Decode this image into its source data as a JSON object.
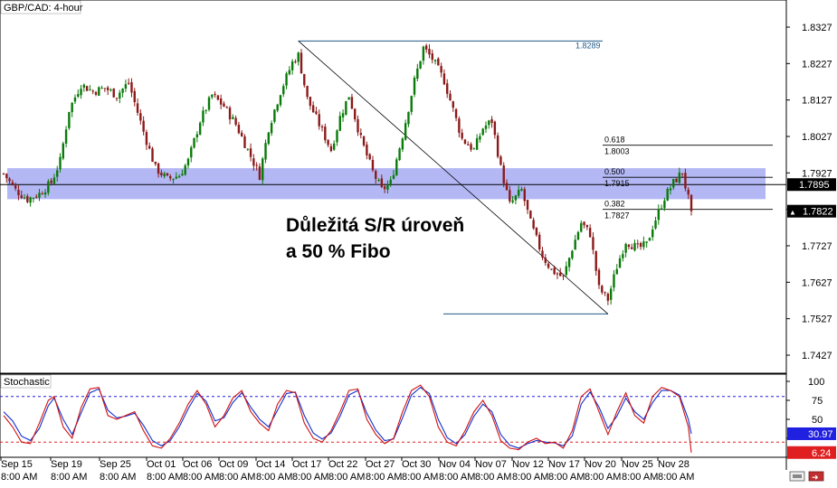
{
  "window": {
    "title": "GBP/CAD: 4-hour",
    "stoch_title": "Stochastic"
  },
  "annotation": {
    "line1": "Důležitá S/R úroveň",
    "line2": "a 50 % Fibo"
  },
  "colors": {
    "up_candle": "#0a7a0a",
    "down_candle": "#8b1a1a",
    "sr_zone": "#9aa0f0",
    "stoch_k": "#d01010",
    "stoch_d": "#1030d0",
    "level_line": "#000000",
    "badge_dark": "#000000",
    "badge_blue": "#2020e0",
    "badge_red": "#e02020"
  },
  "chart_data": [
    {
      "type": "candlestick",
      "title": "GBP/CAD: 4-hour",
      "ylim": [
        1.742,
        1.835
      ],
      "yticks": [
        "1.8327",
        "1.8227",
        "1.8127",
        "1.8027",
        "1.7927",
        "1.7827",
        "1.7727",
        "1.7627",
        "1.7527",
        "1.7427"
      ],
      "ytick_values": [
        1.8327,
        1.8227,
        1.8127,
        1.8027,
        1.7927,
        1.7827,
        1.7727,
        1.7627,
        1.7527,
        1.7427
      ],
      "xtick_dates": [
        "Sep 15",
        "Sep 19",
        "Sep 25",
        "Oct 01",
        "Oct 06",
        "Oct 09",
        "Oct 14",
        "Oct 17",
        "Oct 22",
        "Oct 27",
        "Oct 30",
        "Nov 04",
        "Nov 07",
        "Nov 12",
        "Nov 17",
        "Nov 20",
        "Nov 25",
        "Nov 28"
      ],
      "xtick_times": [
        "8:00 AM",
        "8:00 AM",
        "8:00 AM",
        "8:00 AM",
        "8:00 AM",
        "8:00 AM",
        "8:00 AM",
        "8:00 AM",
        "8:00 AM",
        "8:00 AM",
        "8:00 AM",
        "8:00 AM",
        "8:00 AM",
        "8:00 AM",
        "8:00 AM",
        "8:00 AM",
        "8:00 AM",
        "8:00 AM"
      ],
      "price_path": [
        [
          0,
          1.7925
        ],
        [
          4,
          1.788
        ],
        [
          8,
          1.7855
        ],
        [
          12,
          1.787
        ],
        [
          16,
          1.79
        ],
        [
          19,
          1.796
        ],
        [
          22,
          1.81
        ],
        [
          26,
          1.817
        ],
        [
          30,
          1.815
        ],
        [
          34,
          1.816
        ],
        [
          38,
          1.814
        ],
        [
          42,
          1.8175
        ],
        [
          44,
          1.812
        ],
        [
          47,
          1.804
        ],
        [
          51,
          1.794
        ],
        [
          55,
          1.791
        ],
        [
          59,
          1.792
        ],
        [
          62,
          1.796
        ],
        [
          66,
          1.807
        ],
        [
          70,
          1.814
        ],
        [
          74,
          1.811
        ],
        [
          78,
          1.806
        ],
        [
          82,
          1.799
        ],
        [
          86,
          1.792
        ],
        [
          89,
          1.805
        ],
        [
          93,
          1.815
        ],
        [
          97,
          1.823
        ],
        [
          99,
          1.825
        ],
        [
          102,
          1.813
        ],
        [
          106,
          1.806
        ],
        [
          110,
          1.799
        ],
        [
          113,
          1.808
        ],
        [
          116,
          1.814
        ],
        [
          120,
          1.802
        ],
        [
          124,
          1.793
        ],
        [
          127,
          1.788
        ],
        [
          130,
          1.79
        ],
        [
          134,
          1.803
        ],
        [
          138,
          1.818
        ],
        [
          141,
          1.827
        ],
        [
          144,
          1.824
        ],
        [
          148,
          1.818
        ],
        [
          151,
          1.81
        ],
        [
          154,
          1.802
        ],
        [
          158,
          1.799
        ],
        [
          161,
          1.805
        ],
        [
          164,
          1.807
        ],
        [
          167,
          1.794
        ],
        [
          170,
          1.784
        ],
        [
          174,
          1.788
        ],
        [
          177,
          1.779
        ],
        [
          181,
          1.77
        ],
        [
          184,
          1.766
        ],
        [
          188,
          1.764
        ],
        [
          191,
          1.772
        ],
        [
          194,
          1.779
        ],
        [
          197,
          1.776
        ],
        [
          200,
          1.761
        ],
        [
          203,
          1.758
        ],
        [
          206,
          1.767
        ],
        [
          209,
          1.774
        ],
        [
          213,
          1.772
        ],
        [
          216,
          1.773
        ],
        [
          218,
          1.778
        ],
        [
          222,
          1.786
        ],
        [
          225,
          1.79
        ],
        [
          228,
          1.793
        ],
        [
          229,
          1.789
        ],
        [
          231,
          1.7822
        ]
      ],
      "resistance_zone": [
        1.7855,
        1.794
      ],
      "levels": [
        {
          "label": "1.8289",
          "price": 1.8289
        },
        {
          "label": "0.618",
          "price": 1.8003,
          "value_label": "1.8003"
        },
        {
          "label": "0.500",
          "price": 1.7915,
          "value_label": "1.7915"
        },
        {
          "label": "0.382",
          "price": 1.7827,
          "value_label": "1.7827"
        }
      ],
      "swing_high": {
        "price": 1.8289,
        "label": "1.8289"
      },
      "swing_low": {
        "price": 1.754
      },
      "price_badges": [
        {
          "label": "1.7895",
          "price": 1.7895,
          "style": "dark"
        },
        {
          "label": "1.7822",
          "price": 1.7822,
          "style": "dark",
          "marker": "▲"
        }
      ]
    },
    {
      "type": "line",
      "title": "Stochastic",
      "ylim": [
        0,
        100
      ],
      "yticks": [
        "100",
        "75",
        "50",
        "25",
        "0"
      ],
      "ytick_values": [
        100,
        75,
        50,
        25,
        0
      ],
      "overbought": 80,
      "oversold": 20,
      "k_path": [
        [
          0,
          55
        ],
        [
          3,
          40
        ],
        [
          6,
          20
        ],
        [
          9,
          18
        ],
        [
          12,
          45
        ],
        [
          15,
          75
        ],
        [
          17,
          80
        ],
        [
          20,
          40
        ],
        [
          23,
          25
        ],
        [
          26,
          65
        ],
        [
          29,
          90
        ],
        [
          32,
          92
        ],
        [
          35,
          55
        ],
        [
          38,
          50
        ],
        [
          41,
          55
        ],
        [
          44,
          60
        ],
        [
          47,
          35
        ],
        [
          50,
          15
        ],
        [
          53,
          12
        ],
        [
          56,
          25
        ],
        [
          59,
          45
        ],
        [
          62,
          70
        ],
        [
          65,
          88
        ],
        [
          68,
          70
        ],
        [
          71,
          40
        ],
        [
          74,
          55
        ],
        [
          77,
          78
        ],
        [
          80,
          88
        ],
        [
          83,
          60
        ],
        [
          86,
          45
        ],
        [
          89,
          35
        ],
        [
          92,
          70
        ],
        [
          95,
          88
        ],
        [
          98,
          85
        ],
        [
          101,
          45
        ],
        [
          104,
          25
        ],
        [
          107,
          20
        ],
        [
          110,
          35
        ],
        [
          113,
          60
        ],
        [
          116,
          88
        ],
        [
          119,
          90
        ],
        [
          122,
          50
        ],
        [
          125,
          30
        ],
        [
          128,
          18
        ],
        [
          131,
          25
        ],
        [
          134,
          60
        ],
        [
          137,
          88
        ],
        [
          140,
          95
        ],
        [
          143,
          80
        ],
        [
          146,
          40
        ],
        [
          149,
          20
        ],
        [
          152,
          15
        ],
        [
          155,
          35
        ],
        [
          158,
          60
        ],
        [
          161,
          75
        ],
        [
          164,
          55
        ],
        [
          167,
          22
        ],
        [
          170,
          12
        ],
        [
          173,
          10
        ],
        [
          176,
          20
        ],
        [
          179,
          25
        ],
        [
          182,
          18
        ],
        [
          185,
          20
        ],
        [
          188,
          12
        ],
        [
          191,
          35
        ],
        [
          194,
          80
        ],
        [
          197,
          90
        ],
        [
          200,
          60
        ],
        [
          203,
          30
        ],
        [
          206,
          60
        ],
        [
          209,
          85
        ],
        [
          212,
          55
        ],
        [
          215,
          45
        ],
        [
          218,
          80
        ],
        [
          221,
          92
        ],
        [
          224,
          88
        ],
        [
          227,
          80
        ],
        [
          230,
          40
        ],
        [
          231,
          6.24
        ]
      ],
      "d_path": [
        [
          0,
          60
        ],
        [
          3,
          48
        ],
        [
          6,
          28
        ],
        [
          9,
          22
        ],
        [
          12,
          38
        ],
        [
          15,
          68
        ],
        [
          17,
          78
        ],
        [
          20,
          50
        ],
        [
          23,
          30
        ],
        [
          26,
          58
        ],
        [
          29,
          85
        ],
        [
          32,
          90
        ],
        [
          35,
          62
        ],
        [
          38,
          52
        ],
        [
          41,
          54
        ],
        [
          44,
          58
        ],
        [
          47,
          42
        ],
        [
          50,
          22
        ],
        [
          53,
          15
        ],
        [
          56,
          22
        ],
        [
          59,
          40
        ],
        [
          62,
          64
        ],
        [
          65,
          84
        ],
        [
          68,
          74
        ],
        [
          71,
          48
        ],
        [
          74,
          52
        ],
        [
          77,
          72
        ],
        [
          80,
          85
        ],
        [
          83,
          66
        ],
        [
          86,
          50
        ],
        [
          89,
          40
        ],
        [
          92,
          62
        ],
        [
          95,
          84
        ],
        [
          98,
          86
        ],
        [
          101,
          55
        ],
        [
          104,
          32
        ],
        [
          107,
          24
        ],
        [
          110,
          32
        ],
        [
          113,
          54
        ],
        [
          116,
          82
        ],
        [
          119,
          88
        ],
        [
          122,
          58
        ],
        [
          125,
          36
        ],
        [
          128,
          22
        ],
        [
          131,
          24
        ],
        [
          134,
          52
        ],
        [
          137,
          82
        ],
        [
          140,
          92
        ],
        [
          143,
          84
        ],
        [
          146,
          50
        ],
        [
          149,
          26
        ],
        [
          152,
          18
        ],
        [
          155,
          30
        ],
        [
          158,
          54
        ],
        [
          161,
          70
        ],
        [
          164,
          60
        ],
        [
          167,
          30
        ],
        [
          170,
          16
        ],
        [
          173,
          12
        ],
        [
          176,
          18
        ],
        [
          179,
          22
        ],
        [
          182,
          20
        ],
        [
          185,
          19
        ],
        [
          188,
          15
        ],
        [
          191,
          28
        ],
        [
          194,
          70
        ],
        [
          197,
          86
        ],
        [
          200,
          66
        ],
        [
          203,
          38
        ],
        [
          206,
          54
        ],
        [
          209,
          78
        ],
        [
          212,
          60
        ],
        [
          215,
          50
        ],
        [
          218,
          72
        ],
        [
          221,
          88
        ],
        [
          224,
          88
        ],
        [
          227,
          82
        ],
        [
          230,
          50
        ],
        [
          231,
          30.97
        ]
      ],
      "badges": [
        {
          "label": "30.97",
          "value": 30.97,
          "style": "blue"
        },
        {
          "label": "6.24",
          "value": 6.24,
          "style": "red"
        }
      ]
    }
  ]
}
